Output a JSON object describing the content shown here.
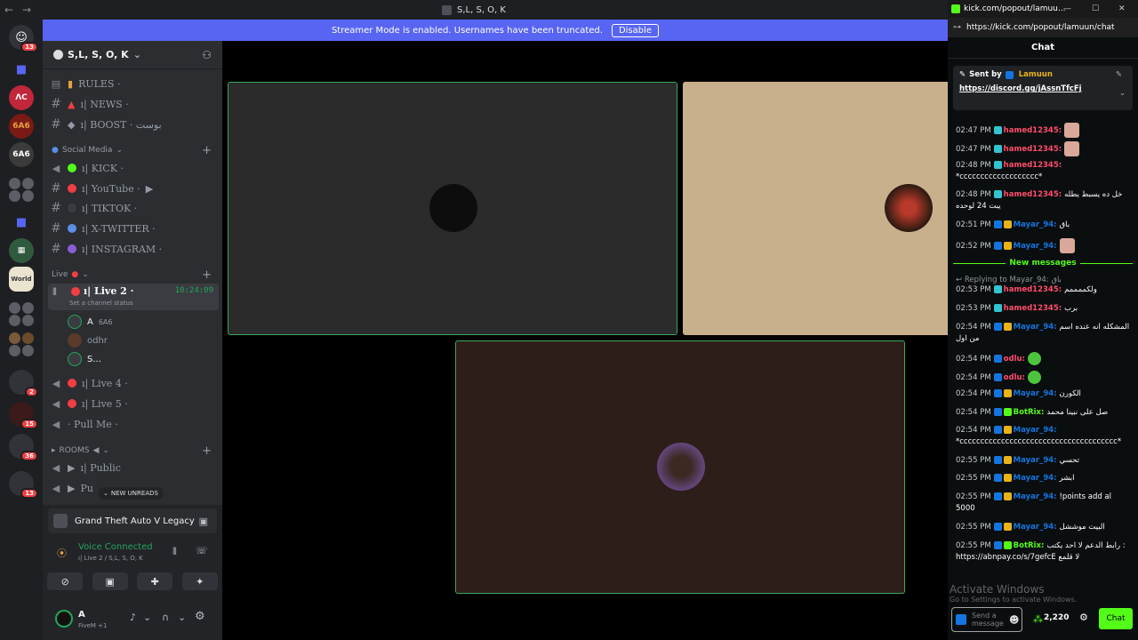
{
  "window": {
    "title": "S,L, S, O, K"
  },
  "banner": {
    "text": "Streamer Mode is enabled. Usernames have been truncated.",
    "button": "Disable"
  },
  "rail": {
    "badges": [
      "13",
      "2",
      "15",
      "36",
      "13"
    ],
    "labels": [
      "6A6",
      "6A6"
    ]
  },
  "server": {
    "name": "S,L, S, O, K"
  },
  "channels": {
    "top": [
      {
        "label": "RULES ·"
      },
      {
        "label": "ı| NEWS ·"
      },
      {
        "label": "ı| BOOST · بوست"
      }
    ],
    "social_cat": "Social Media",
    "social": [
      {
        "label": "ı| KICK ·",
        "color": "#53fc18"
      },
      {
        "label": "ı| YouTube ·",
        "color": "#f23f43"
      },
      {
        "label": "ı| TIKTOK ·",
        "color": "#3a3c41"
      },
      {
        "label": "ı| X-TWITTER ·",
        "color": "#5b8ee6"
      },
      {
        "label": "ı| INSTAGRAM ·",
        "color": "#8a5fd6"
      }
    ],
    "live_cat": "Live",
    "live2": {
      "label": "ı| Live 2 ·",
      "time": "10:24:09",
      "status": "Set a channel status"
    },
    "users": [
      "A",
      "odhr",
      "S..."
    ],
    "user_a_tag": "6A6",
    "live4": "ı| Live 4 ·",
    "live5": "ı| Live 5 ·",
    "pullme": "· Pull Me ·",
    "rooms_cat": "ROOMS",
    "public": "ı| Public",
    "public2": "Pu",
    "new_unreads": "NEW UNREADS"
  },
  "voice": {
    "activity": "Grand Theft Auto V Legacy",
    "status": "Voice Connected",
    "channel": "ı| Live 2 / S,L, S, O, K",
    "user": "A",
    "user_sub": "FiveM +1"
  },
  "kick": {
    "tab_title": "kick.com/popout/lamuu...",
    "url": "https://kick.com/popout/lamuun/chat",
    "header": "Chat",
    "pinned": {
      "sent_by": "Sent by",
      "user": "Lamuun",
      "link": "https://discord.gg/jAssnTfcFj"
    },
    "new_messages": "New messages",
    "reply_to": "Replying to Mayar_94: باق",
    "messages": [
      {
        "time": "02:47 PM",
        "user": "hamed12345:",
        "text": "",
        "color": "#ff4d6d"
      },
      {
        "time": "02:47 PM",
        "user": "hamed12345:",
        "text": "",
        "color": "#ff4d6d"
      },
      {
        "time": "02:48 PM",
        "user": "hamed12345:",
        "text": "*ccccccccccccccccccc*",
        "color": "#ff4d6d"
      },
      {
        "time": "02:48 PM",
        "user": "hamed12345:",
        "text": "خل ده يسبط يطله يبت 24 لوحده",
        "color": "#ff4d6d"
      },
      {
        "time": "02:51 PM",
        "user": "Mayar_94:",
        "text": "باق",
        "color": "#1475e1"
      },
      {
        "time": "02:52 PM",
        "user": "Mayar_94:",
        "text": "",
        "color": "#1475e1"
      },
      {
        "time": "02:53 PM",
        "user": "hamed12345:",
        "text": "ولكممممم",
        "color": "#ff4d6d"
      },
      {
        "time": "02:53 PM",
        "user": "hamed12345:",
        "text": "برب",
        "color": "#ff4d6d"
      },
      {
        "time": "02:54 PM",
        "user": "Mayar_94:",
        "text": "المشكله انه عنده اسم من اول",
        "color": "#1475e1"
      },
      {
        "time": "02:54 PM",
        "user": "odlu:",
        "text": "",
        "color": "#ff4d6d"
      },
      {
        "time": "02:54 PM",
        "user": "odlu:",
        "text": "",
        "color": "#ff4d6d"
      },
      {
        "time": "02:54 PM",
        "user": "Mayar_94:",
        "text": "الكورن",
        "color": "#1475e1"
      },
      {
        "time": "02:54 PM",
        "user": "BotRix:",
        "text": "صل على نبينا محمد",
        "color": "#53fc18"
      },
      {
        "time": "02:54 PM",
        "user": "Mayar_94:",
        "text": "*cccccccccccccccccccccccccccccccccccccc*",
        "color": "#1475e1"
      },
      {
        "time": "02:55 PM",
        "user": "Mayar_94:",
        "text": "تحسي",
        "color": "#1475e1"
      },
      {
        "time": "02:55 PM",
        "user": "Mayar_94:",
        "text": "ابشر",
        "color": "#1475e1"
      },
      {
        "time": "02:55 PM",
        "user": "Mayar_94:",
        "text": "!points add al 5000",
        "color": "#1475e1"
      },
      {
        "time": "02:55 PM",
        "user": "Mayar_94:",
        "text": "البيت موششل",
        "color": "#1475e1"
      },
      {
        "time": "02:55 PM",
        "user": "BotRix:",
        "text": "رابط الدعم لا احد يكتب : https://abnpay.co/s/7gefcE لا قلمع",
        "color": "#53fc18"
      }
    ],
    "input_placeholder": "Send a message",
    "points": "2,220",
    "chat_button": "Chat",
    "watermark1": "Activate Windows",
    "watermark2": "Go to Settings to activate Windows."
  },
  "colors": {
    "accent": "#5865f2",
    "kick_green": "#53fc18",
    "live_red": "#f23f43",
    "tile_border": "#3ba55d"
  }
}
